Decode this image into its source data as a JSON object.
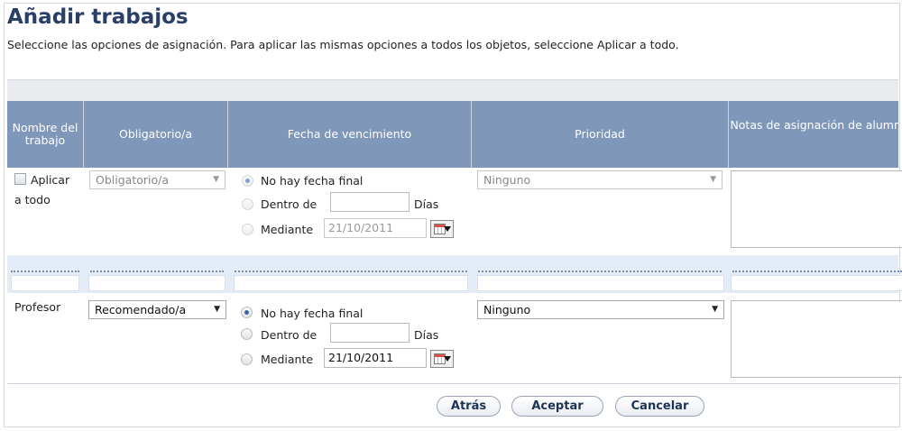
{
  "page": {
    "title": "Añadir trabajos",
    "subtitle": "Seleccione las opciones de asignación. Para aplicar las mismas opciones a todos los objetos, seleccione Aplicar a todo."
  },
  "table": {
    "headers": {
      "name": "Nombre del trabajo",
      "required": "Obligatorio/a",
      "due": "Fecha de vencimiento",
      "priority": "Prioridad",
      "notes": "Notas de asignación de alumno"
    }
  },
  "apply_all": {
    "checkbox_label": "Aplicar",
    "checkbox_label_2": "a todo",
    "required_value": "Obligatorio/a",
    "due": {
      "no_end_label": "No hay fecha final",
      "within_label": "Dentro de",
      "within_value": "",
      "days_label": "Días",
      "by_label": "Mediante",
      "by_value": "21/10/2011",
      "selected": "no_end"
    },
    "priority_value": "Ninguno"
  },
  "row": {
    "name": "Profesor",
    "required_value": "Recomendado/a",
    "due": {
      "no_end_label": "No hay fecha final",
      "within_label": "Dentro de",
      "within_value": "",
      "days_label": "Días",
      "by_label": "Mediante",
      "by_value": "21/10/2011",
      "selected": "no_end"
    },
    "priority_value": "Ninguno"
  },
  "buttons": {
    "back": "Atrás",
    "accept": "Aceptar",
    "cancel": "Cancelar"
  },
  "icons": {
    "dropdown": "chevron-down-icon",
    "calendar": "calendar-icon"
  },
  "colors": {
    "header_bg": "#7f97b9",
    "title": "#2a3f66",
    "band": "#e4ecf7"
  }
}
